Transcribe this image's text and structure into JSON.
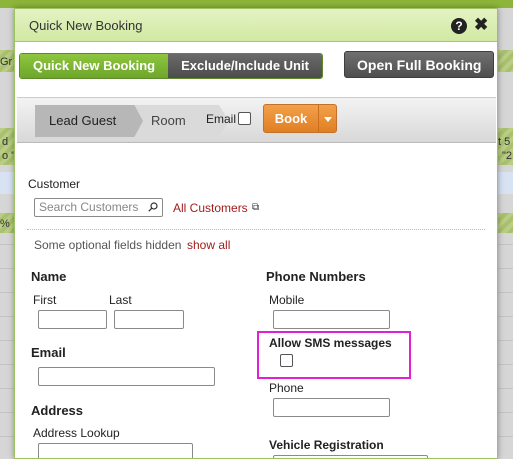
{
  "background": {
    "left_snippets": [
      "Gr",
      "d",
      "o \"",
      "%"
    ],
    "right_snippets": [
      "t 5",
      "\"2"
    ]
  },
  "dialog": {
    "title": "Quick New Booking",
    "help_icon": "help-icon",
    "close_icon": "close-icon",
    "tabs": [
      {
        "label": "Quick New Booking",
        "active": true
      },
      {
        "label": "Exclude/Include Unit",
        "active": false
      }
    ],
    "open_full_booking_label": "Open Full Booking",
    "steps": [
      "Lead Guest",
      "Room"
    ],
    "email_label": "Email",
    "email_checked": false,
    "book_label": "Book"
  },
  "customer": {
    "label": "Customer",
    "search_placeholder": "Search Customers",
    "all_customers_link": "All Customers",
    "optional_note": "Some optional fields hidden",
    "show_all_link": "show all"
  },
  "form": {
    "name_label": "Name",
    "first_label": "First",
    "last_label": "Last",
    "email_label": "Email",
    "address_label": "Address",
    "address_lookup_label": "Address Lookup",
    "phone_numbers_label": "Phone Numbers",
    "mobile_label": "Mobile",
    "allow_sms_label": "Allow SMS messages",
    "allow_sms_checked": false,
    "phone_label": "Phone",
    "vehicle_label": "Vehicle Registration"
  },
  "colors": {
    "accent_green": "#8ec63f",
    "book_orange": "#e88c31",
    "link_red": "#a11d1d",
    "highlight_magenta": "#e020d6"
  }
}
